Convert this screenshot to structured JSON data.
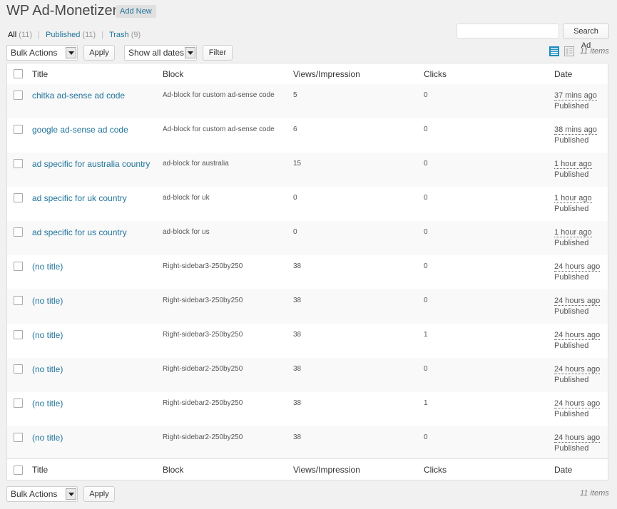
{
  "page": {
    "title": "WP Ad-Monetizer",
    "add_new": "Add New"
  },
  "filters": {
    "all_label": "All",
    "all_count": "(11)",
    "published_label": "Published",
    "published_count": "(11)",
    "trash_label": "Trash",
    "trash_count": "(9)",
    "sep": "|"
  },
  "search": {
    "value": "",
    "button": "Search Ad"
  },
  "toolbar": {
    "bulk_actions": "Bulk Actions",
    "apply": "Apply",
    "dates": "Show all dates",
    "filter": "Filter",
    "items_count": "11 items"
  },
  "columns": {
    "title": "Title",
    "block": "Block",
    "views": "Views/Impression",
    "clicks": "Clicks",
    "date": "Date"
  },
  "rows": [
    {
      "title": "chitka ad-sense ad code",
      "block": "Ad-block for custom ad-sense code",
      "views": "5",
      "clicks": "0",
      "date": "37 mins ago",
      "status": "Published"
    },
    {
      "title": "google ad-sense ad code",
      "block": "Ad-block for custom ad-sense code",
      "views": "6",
      "clicks": "0",
      "date": "38 mins ago",
      "status": "Published"
    },
    {
      "title": "ad specific for australia country",
      "block": "ad-block for australia",
      "views": "15",
      "clicks": "0",
      "date": "1 hour ago",
      "status": "Published"
    },
    {
      "title": "ad specific for uk country",
      "block": "ad-block for uk",
      "views": "0",
      "clicks": "0",
      "date": "1 hour ago",
      "status": "Published"
    },
    {
      "title": "ad specific for us country",
      "block": "ad-block for us",
      "views": "0",
      "clicks": "0",
      "date": "1 hour ago",
      "status": "Published"
    },
    {
      "title": "(no title)",
      "block": "Right-sidebar3-250by250",
      "views": "38",
      "clicks": "0",
      "date": "24 hours ago",
      "status": "Published"
    },
    {
      "title": "(no title)",
      "block": "Right-sidebar3-250by250",
      "views": "38",
      "clicks": "0",
      "date": "24 hours ago",
      "status": "Published"
    },
    {
      "title": "(no title)",
      "block": "Right-sidebar3-250by250",
      "views": "38",
      "clicks": "1",
      "date": "24 hours ago",
      "status": "Published"
    },
    {
      "title": "(no title)",
      "block": "Right-sidebar2-250by250",
      "views": "38",
      "clicks": "0",
      "date": "24 hours ago",
      "status": "Published"
    },
    {
      "title": "(no title)",
      "block": "Right-sidebar2-250by250",
      "views": "38",
      "clicks": "1",
      "date": "24 hours ago",
      "status": "Published"
    },
    {
      "title": "(no title)",
      "block": "Right-sidebar2-250by250",
      "views": "38",
      "clicks": "0",
      "date": "24 hours ago",
      "status": "Published"
    }
  ],
  "colors": {
    "link": "#21759b",
    "background": "#f1f1f1",
    "view_list_active": "#1e8cbe"
  },
  "icons": {
    "list_view": "list-view-icon",
    "excerpt_view": "excerpt-view-icon"
  }
}
